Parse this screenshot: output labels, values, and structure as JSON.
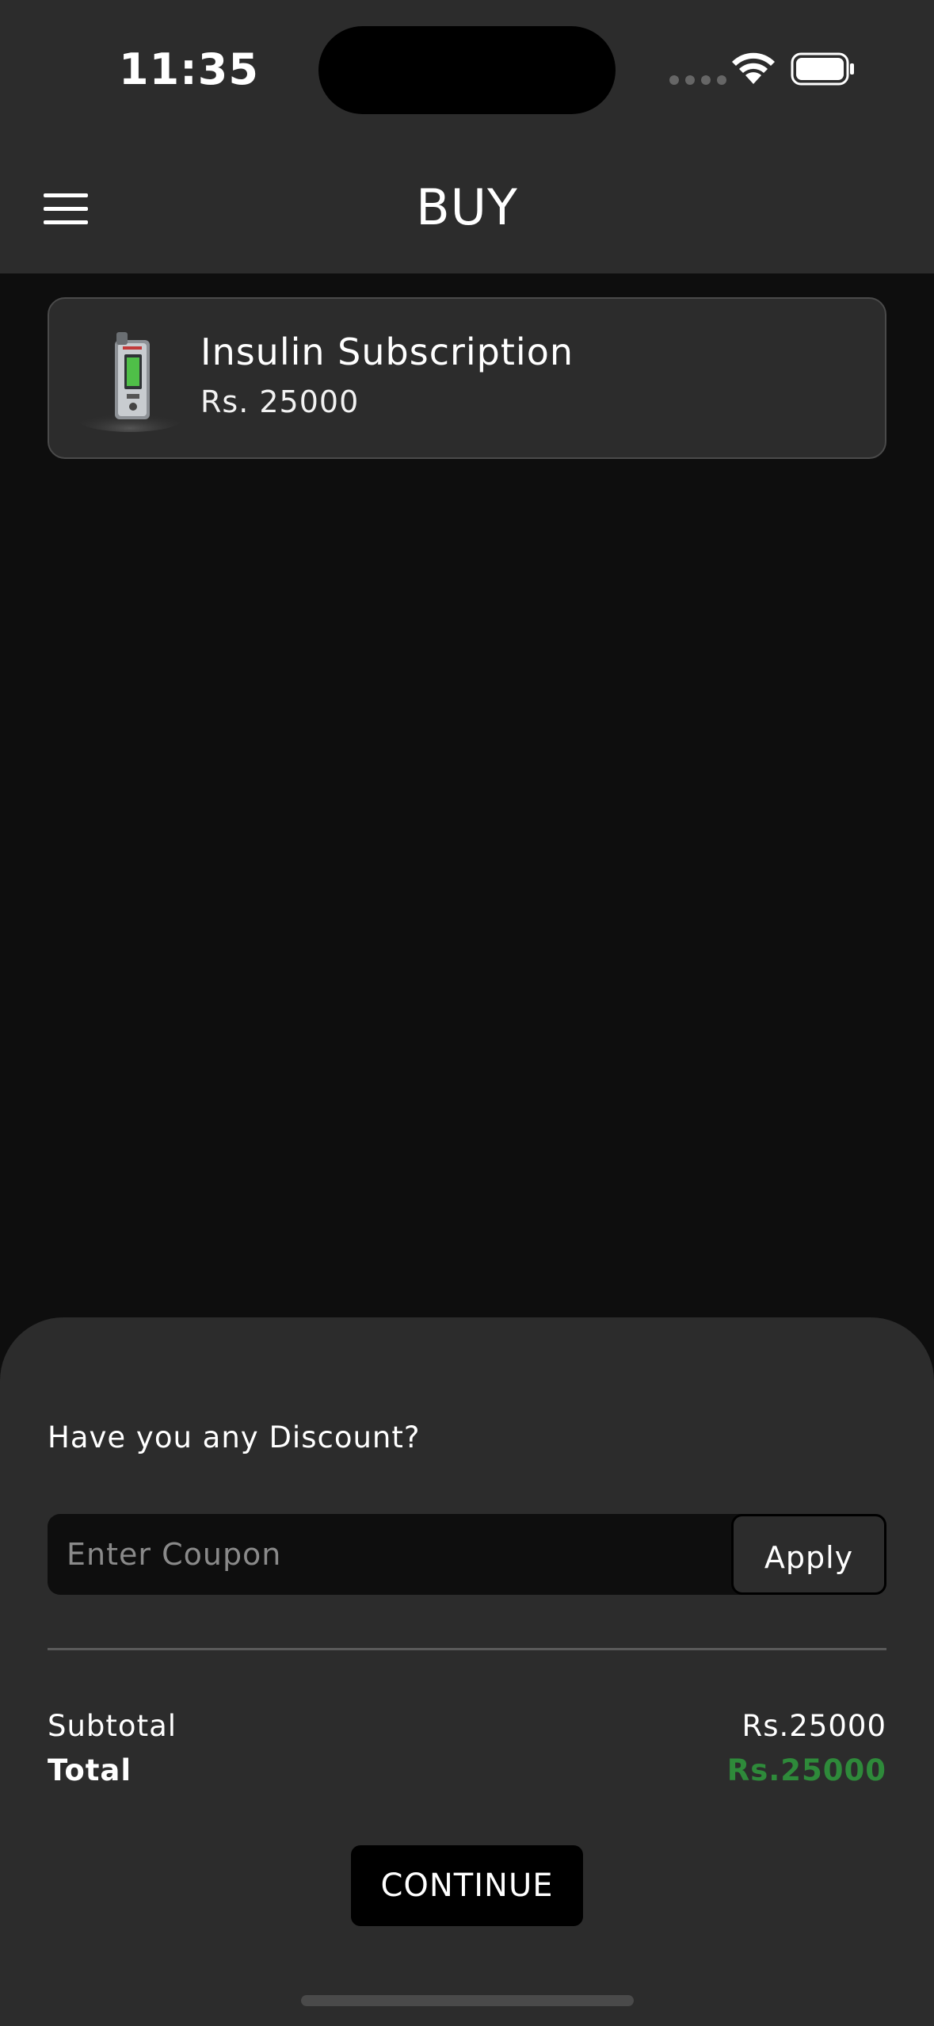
{
  "status_bar": {
    "time": "11:35"
  },
  "header": {
    "title": "BUY",
    "menu_icon": "hamburger-menu-icon"
  },
  "cart": {
    "items": [
      {
        "name": "Insulin Subscription",
        "price": "Rs. 25000",
        "thumbnail_icon": "insulin-pump-image"
      }
    ]
  },
  "checkout": {
    "discount_prompt": "Have you any Discount?",
    "coupon_placeholder": "Enter Coupon",
    "coupon_value": "",
    "apply_label": "Apply",
    "subtotal_label": "Subtotal",
    "subtotal_value": "Rs.25000",
    "total_label": "Total",
    "total_value": "Rs.25000",
    "continue_label": "CONTINUE"
  },
  "colors": {
    "background": "#0e0e0e",
    "surface": "#2c2c2c",
    "accent_total": "#2e8a3a"
  }
}
